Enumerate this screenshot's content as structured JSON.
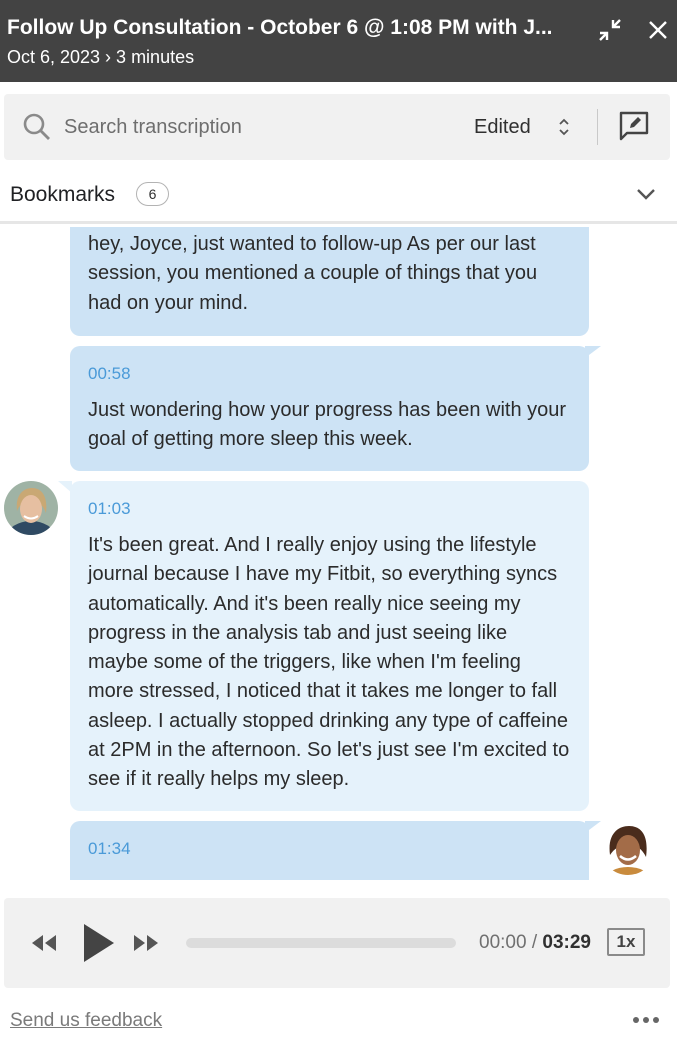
{
  "header": {
    "title": "Follow Up Consultation - October 6 @ 1:08 PM with J...",
    "subtitle": "Oct 6, 2023 › 3 minutes"
  },
  "search": {
    "placeholder": "Search transcription",
    "version_label": "Edited"
  },
  "bookmarks": {
    "label": "Bookmarks",
    "count": "6"
  },
  "transcript": {
    "entries": [
      {
        "speaker": "coach",
        "timestamp": "",
        "text": "hey, Joyce, just wanted to follow-up As per our last session, you mentioned a couple of things that you had on your mind."
      },
      {
        "speaker": "coach",
        "timestamp": "00:58",
        "text": "Just wondering how your progress has been with your goal of getting more sleep this week."
      },
      {
        "speaker": "client",
        "timestamp": "01:03",
        "text": "It's been great. And I really enjoy using the lifestyle journal because I have my Fitbit, so everything syncs automatically. And it's been really nice seeing my progress in the analysis tab and just seeing like maybe some of the triggers, like when I'm feeling more stressed, I noticed that it takes me longer to fall asleep. I actually stopped drinking any type of caffeine at 2PM in the afternoon. So let's just see I'm excited to see if it really helps my sleep."
      },
      {
        "speaker": "coach",
        "timestamp": "01:34",
        "text": ""
      }
    ]
  },
  "player": {
    "current_time": "00:00",
    "separator": "/",
    "total_time": "03:29",
    "speed": "1x",
    "progress": 0
  },
  "footer": {
    "feedback_link": "Send us feedback"
  },
  "colors": {
    "header_bg": "#434343",
    "coach_bubble": "#cde3f5",
    "client_bubble": "#e5f2fb",
    "timestamp": "#4a9ad8"
  }
}
